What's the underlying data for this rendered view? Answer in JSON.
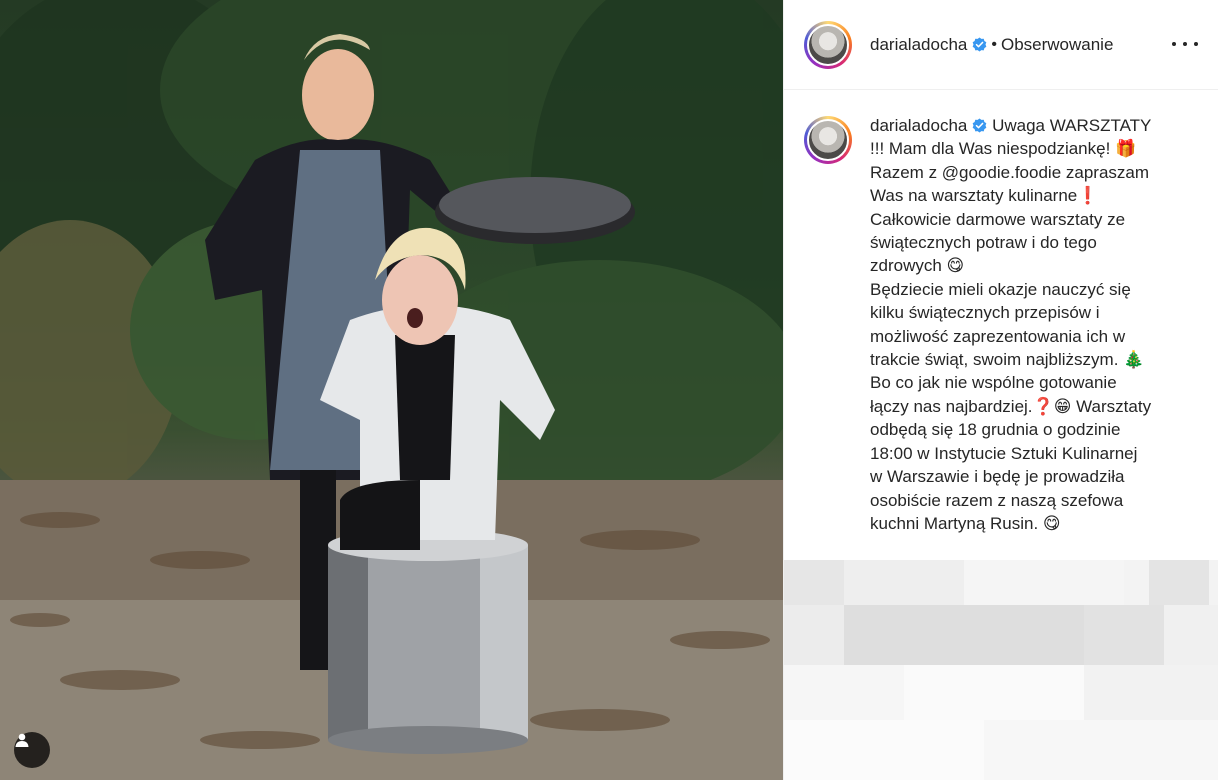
{
  "post": {
    "username": "darialadocha",
    "separator": "•",
    "follow_state": "Obserwowanie",
    "caption_username": "darialadocha",
    "caption_parts": [
      " Uwaga WARSZTATY\n!!! Mam dla Was niespodziankę! 🎁\nRazem z ",
      "@goodie.foodie",
      " zapraszam\nWas na warsztaty kulinarne❗️\nCałkowicie darmowe warsztaty ze\nświątecznych potraw i do tego\nzdrowych 😋\nBędziecie mieli okazje nauczyć się\nkilku świątecznych przepisów i\nmożliwość zaprezentowania ich w\ntrakcie świąt, swoim najbliższym. 🎄\nBo co jak nie wspólne gotowanie\nłączy nas najbardziej.❓😁 Warsztaty\nodbędą się 18 grudnia o godzinie\n18:00 w Instytucie Sztuki Kulinarnej\nw Warszawie i będę je prowadziła\nosobiście razem z naszą szefowa\nkuchni Martyną Rusin. 😋"
    ]
  },
  "icons": {
    "verified": "verified-badge-icon",
    "more": "more-options-icon",
    "tag": "user-tag-icon"
  },
  "colors": {
    "verified_blue": "#3897f0",
    "text": "#262626",
    "divider": "#efefef"
  }
}
